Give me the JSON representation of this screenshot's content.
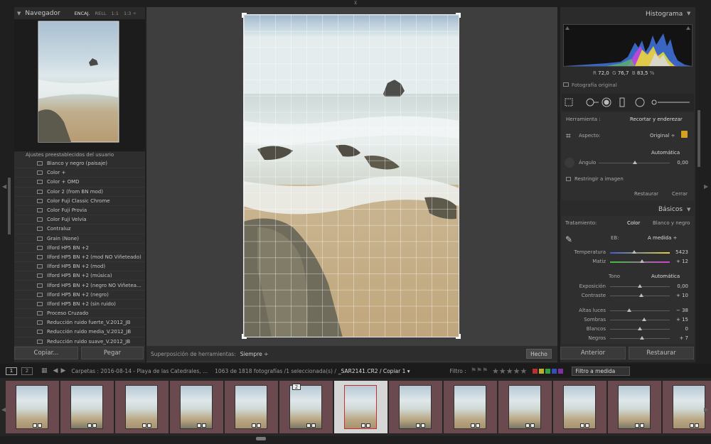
{
  "navigator": {
    "title": "Navegador",
    "zoom_options": [
      "ENCAJ.",
      "RELL",
      "1:1",
      "1:3 ÷"
    ]
  },
  "presets": {
    "group_label": "Ajustes preestablecidos del usuario",
    "items": [
      "Blanco y negro (paisaje)",
      "Color +",
      "Color + OMD",
      "Color 2 (from BN mod)",
      "Color Fuji Classic Chrome",
      "Color Fuji Provia",
      "Color Fuji Velvia",
      "Contraluz",
      "Grain (None)",
      "Ilford HP5 BN +2",
      "Ilford HP5 BN +2 (mod NO Viñeteado)",
      "Ilford HP5 BN +2 (mod)",
      "Ilford HP5 BN +2 (música)",
      "Ilford HP5 BN +2 (negro NO Viñetea...",
      "Ilford HP5 BN +2 (negro)",
      "Ilford HP5 BN +2 (sin ruido)",
      "Proceso Cruzado",
      "Reducción ruido fuerte_V.2012_JB",
      "Reducción ruido media_V.2012_JB",
      "Reducción ruido suave_V.2012_JB"
    ]
  },
  "left_buttons": {
    "copy": "Copiar...",
    "paste": "Pegar"
  },
  "toolbar": {
    "overlay_label": "Superposición de herramientas:",
    "overlay_value": "Siempre ÷",
    "done": "Hecho"
  },
  "histogram": {
    "title": "Histograma",
    "r_label": "R",
    "r_value": "72,0",
    "g_label": "G",
    "g_value": "76,7",
    "b_label": "B",
    "b_value": "83,5",
    "unit": "%",
    "original_label": "Fotografía original"
  },
  "crop": {
    "tool_label": "Herramienta :",
    "tool_name": "Recortar y enderezar",
    "aspect_label": "Aspecto:",
    "aspect_value": "Original ÷",
    "auto_label": "Automática",
    "angle_label": "Ángulo",
    "angle_value": "0,00",
    "constrain_label": "Restringir a imagen",
    "reset": "Restaurar",
    "close": "Cerrar"
  },
  "basics": {
    "title": "Básicos",
    "treatment_label": "Tratamiento:",
    "treatment_color": "Color",
    "treatment_bw": "Blanco y negro",
    "wb_label": "EB:",
    "wb_value": "A medida ÷",
    "temp_label": "Temperatura",
    "temp_value": "5423",
    "tint_label": "Matiz",
    "tint_value": "+ 12",
    "tone_label": "Tono",
    "tone_auto": "Automática",
    "exposure_label": "Exposición",
    "exposure_value": "0,00",
    "contrast_label": "Contraste",
    "contrast_value": "+ 10",
    "highlights_label": "Altas luces",
    "highlights_value": "− 38",
    "shadows_label": "Sombras",
    "shadows_value": "+ 15",
    "whites_label": "Blancos",
    "whites_value": "0",
    "blacks_label": "Negros",
    "blacks_value": "+ 7"
  },
  "right_buttons": {
    "previous": "Anterior",
    "reset": "Restaurar"
  },
  "filmstrip_bar": {
    "screen1": "1",
    "screen2": "2",
    "path": "Carpetas : 2016-08-14 - Playa de las Catedrales, ...",
    "count": "1063 de 1818 fotografías /1 seleccionada(s) /",
    "file": "_SAR2141.CR2 / Copiar 1 ▾",
    "filter_label": "Filtro :",
    "filter_value": "Filtro a medida"
  },
  "filmstrip": {
    "stack_badge": "2",
    "thumb_count": 13,
    "selected_index": 6
  },
  "colors": {
    "accent_select": "#d6d6d6",
    "thumb_bg": "#6b4a4f",
    "selected_border": "#c0303a"
  }
}
